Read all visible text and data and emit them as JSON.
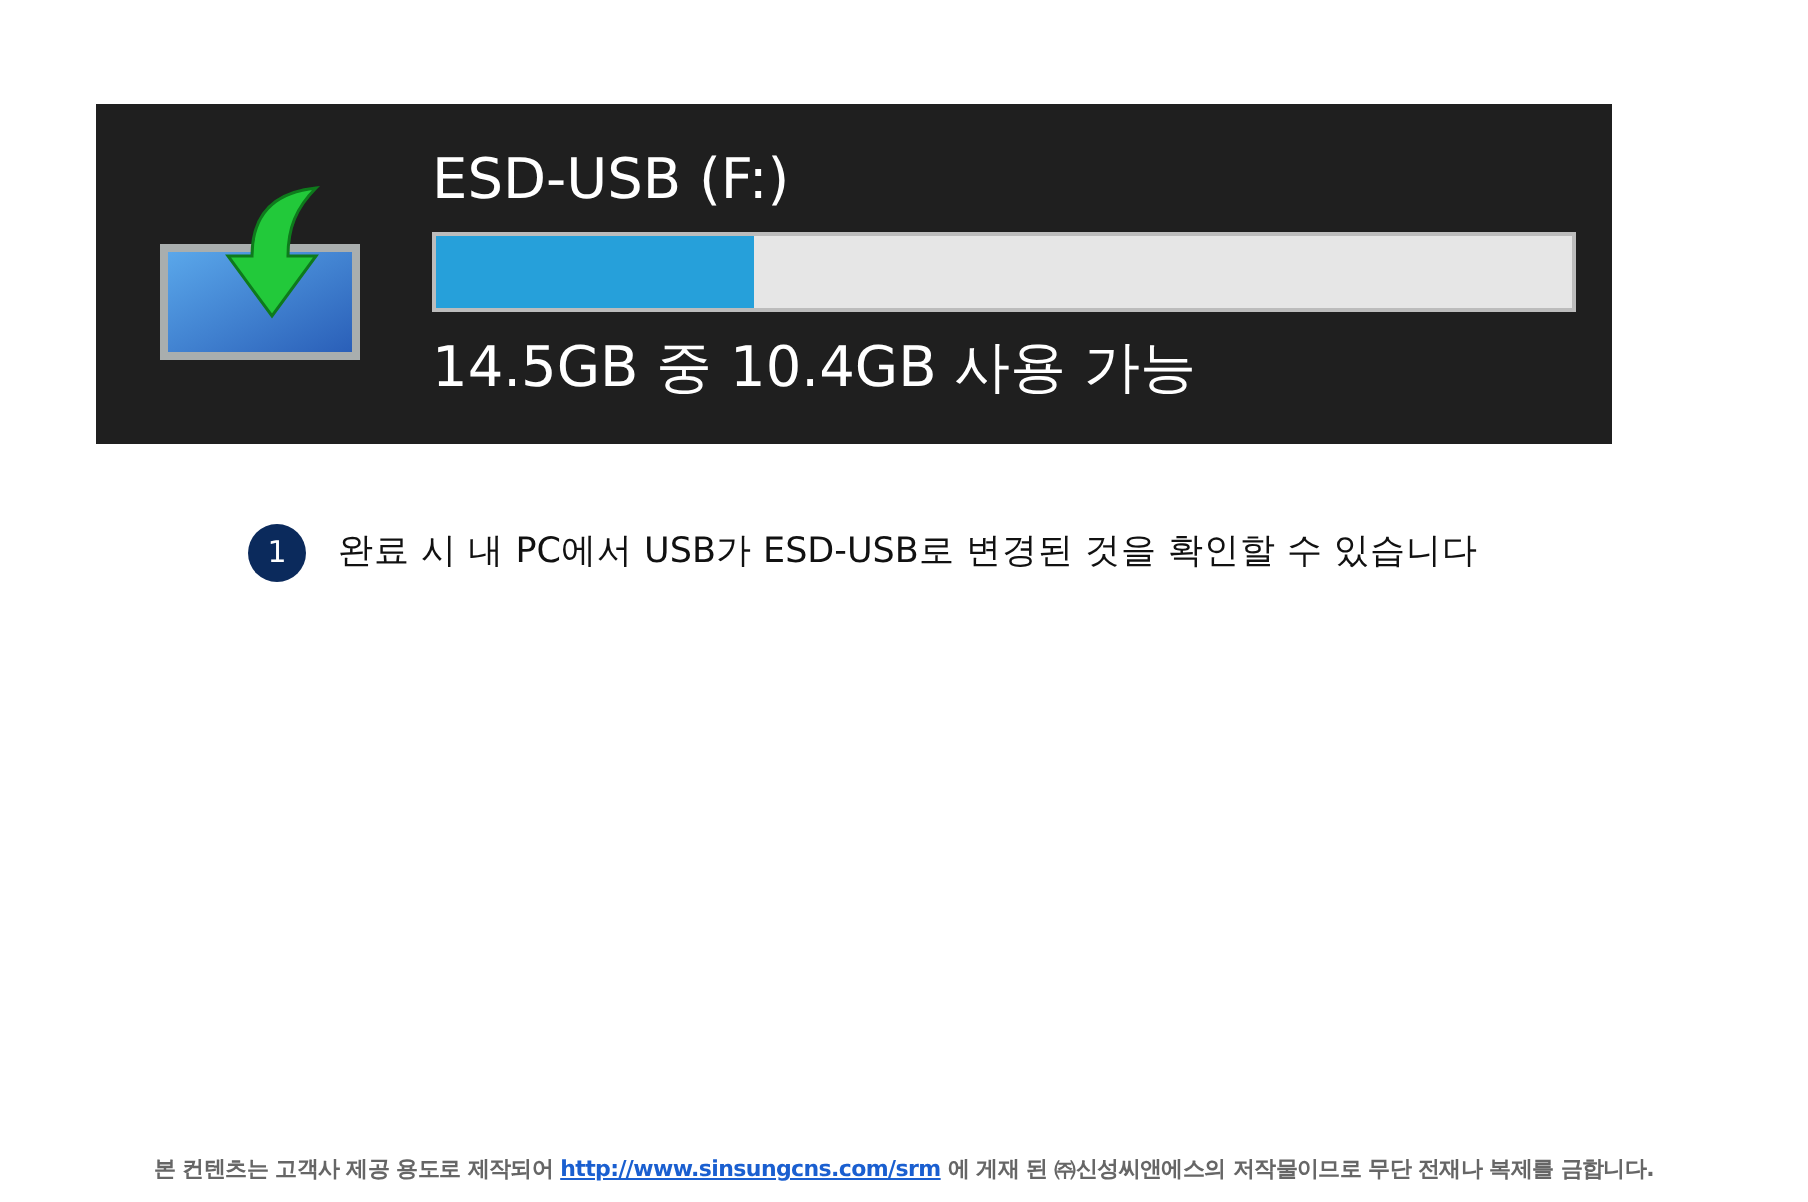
{
  "drive": {
    "name": "ESD-USB (F:)",
    "level": 0.28,
    "caption": "14.5GB 중 10.4GB 사용 가능"
  },
  "step": {
    "number": "1",
    "text": "완료 시 내 PC에서 USB가 ESD-USB로 변경된 것을 확인할 수 있습니다"
  },
  "footer": {
    "before": "본 컨텐츠는 고객사 제공 용도로 제작되어 ",
    "link": "http://www.sinsungcns.com/srm",
    "after": " 에 게재 된 ㈜신성씨앤에스의 저작물이므로 무단 전재나 복제를 금합니다."
  }
}
